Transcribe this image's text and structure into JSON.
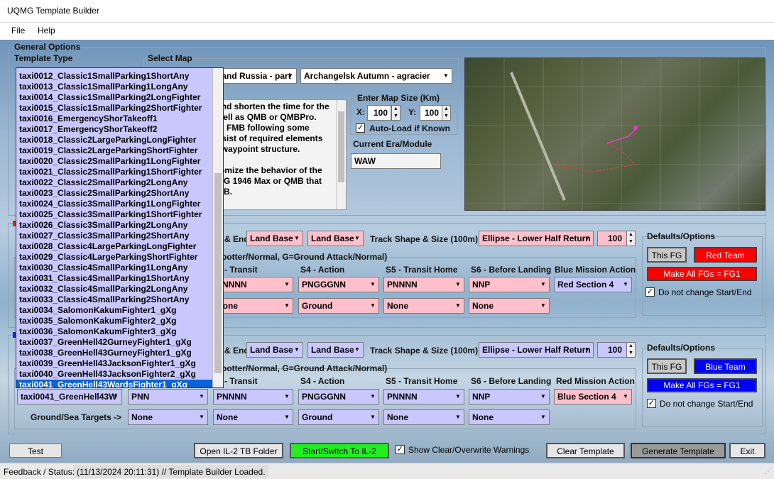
{
  "window": {
    "title": "UQMG Template Builder"
  },
  "menu": {
    "items": [
      "File",
      "Help"
    ]
  },
  "general": {
    "group_label": "General Options",
    "template_type_label": "Template Type",
    "select_map_label": "Select Map",
    "map_region": "Land Russia - part",
    "map_name": "Archangelsk Autumn - agracier",
    "description_lines": [
      "and shorten the time for the",
      "well as QMB or QMBPro.",
      "in FMB following some",
      "nsist of required elements",
      "l waypoint structure.",
      "",
      "tomize the behavior of the",
      "MG 1946 Max or QMB that",
      "MB."
    ],
    "map_size_label": "Enter Map Size (Km)",
    "x_label": "X:",
    "x_value": "100",
    "y_label": "Y:",
    "y_value": "100",
    "autoload_label": "Auto-Load if Known",
    "era_label": "Current Era/Module",
    "era_value": "WAW"
  },
  "dropdown": {
    "items": [
      "taxi0012_Classic1SmallParking1ShortAny",
      "taxi0013_Classic1SmallParking1LongAny",
      "taxi0014_Classic1SmallParking2LongFighter",
      "taxi0015_Classic1SmallParking2ShortFighter",
      "taxi0016_EmergencyShorTakeoff1",
      "taxi0017_EmergencyShorTakeoff2",
      "taxi0018_Classic2LargeParkingLongFighter",
      "taxi0019_Classic2LargeParkingShortFighter",
      "taxi0020_Classic2SmallParking1LongFighter",
      "taxi0021_Classic2SmallParking1ShortFighter",
      "taxi0022_Classic2SmallParking2LongAny",
      "taxi0023_Classic2SmallParking2ShortAny",
      "taxi0024_Classic3SmallParking1LongFighter",
      "taxi0025_Classic3SmallParking1ShortFighter",
      "taxi0026_Classic3SmallParking2LongAny",
      "taxi0027_Classic3SmallParking2ShortAny",
      "taxi0028_Classic4LargeParkingLongFighter",
      "taxi0029_Classic4LargeParkingShortFighter",
      "taxi0030_Classic4SmallParking1LongAny",
      "taxi0031_Classic4SmallParking1ShortAny",
      "taxi0032_Classic4SmallParking2LongAny",
      "taxi0033_Classic4SmallParking2ShortAny",
      "taxi0034_SalomonKakumFighter1_gXg",
      "taxi0035_SalomonKakumFighter2_gXg",
      "taxi0036_SalomonKakumFighter3_gXg",
      "taxi0037_GreenHell42GurneyFighter1_gXg",
      "taxi0038_GreenHell43GurneyFighter1_gXg",
      "taxi0039_GreenHell43JacksonFighter1_gXg",
      "taxi0040_GreenHell43JacksonFighter2_gXg",
      "taxi0041_GreenHell43WardsFighter1_gXg"
    ],
    "selected_index": 29
  },
  "red": {
    "start_end_label": "& End:",
    "start_value": "Land Base",
    "end_value": "Land Base",
    "track_label": "Track Shape & Size (100m):",
    "track_value": "Ellipse - Lower Half Return",
    "size_value": "100",
    "legend": "potter/Normal, G=Ground Attack/Normal)",
    "s3_label": "- Transit",
    "s4_label": "S4 - Action",
    "s5_label": "S5 - Transit Home",
    "s6_label": "S6 - Before Landing",
    "mission_label": "Blue Mission Action",
    "s3_value": "PNNNN",
    "s4_value": "PNGGGNN",
    "s5_value": "PNNNN",
    "s6_value": "NNP",
    "mission_value": "Red Section 4",
    "g3_value": "None",
    "g4_value": "Ground",
    "g5_value": "None",
    "g6_value": "None",
    "defaults_label": "Defaults/Options",
    "this_fg": "This FG",
    "team_btn": "Red Team",
    "make_all": "Make All FGs = FG1",
    "no_change": "Do not change Start/End"
  },
  "blue": {
    "start_end_label": "& End:",
    "start_value": "Land Base",
    "end_value": "Land Base",
    "track_label": "Track Shape & Size (100m):",
    "track_value": "Ellipse - Lower Half Return",
    "size_value": "100",
    "legend": "potter/Normal, G=Ground Attack/Normal)",
    "s3_label": "- Transit",
    "s4_label": "S4 - Action",
    "s5_label": "S5 - Transit Home",
    "s6_label": "S6 - Before Landing",
    "mission_label": "Red Mission Action",
    "takeoff_value": "taxi0041_GreenHell43W",
    "s2_value": "PNN",
    "s3_value": "PNNNN",
    "s4_value": "PNGGGNN",
    "s5_value": "PNNNN",
    "s6_value": "NNP",
    "mission_value": "Blue Section 4",
    "ground_label": "Ground/Sea Targets ->",
    "g2_value": "None",
    "g3_value": "None",
    "g4_value": "Ground",
    "g5_value": "None",
    "g6_value": "None",
    "defaults_label": "Defaults/Options",
    "this_fg": "This FG",
    "team_btn": "Blue Team",
    "make_all": "Make All FGs = FG1",
    "no_change": "Do not change Start/End"
  },
  "bottom": {
    "test": "Test",
    "open_folder": "Open IL-2 TB Folder",
    "start_switch": "Start/Switch To IL-2",
    "show_warnings": "Show Clear/Overwrite Warnings",
    "clear": "Clear Template",
    "generate": "Generate Template",
    "exit": "Exit"
  },
  "status": {
    "label": "Feedback / Status:",
    "text": "(11/13/2024 20:11:31) // Template Builder Loaded."
  },
  "colors": {
    "pink": "#ffc0cb",
    "lavender": "#c8c8ff",
    "selection": "#0a64d8",
    "green_btn": "#22ee22"
  }
}
